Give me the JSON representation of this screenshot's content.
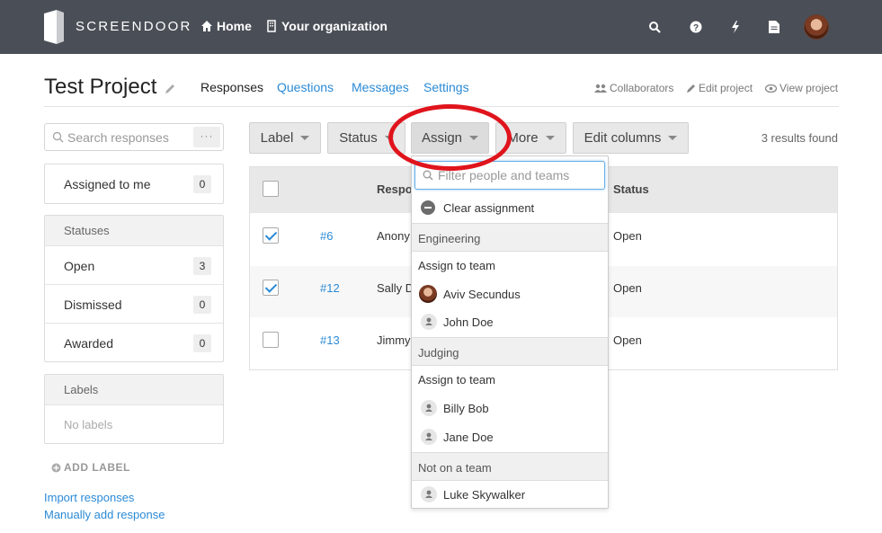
{
  "topbar": {
    "brand": "SCREENDOOR",
    "home_label": "Home",
    "org_label": "Your organization",
    "icons": [
      "search-icon",
      "help-icon",
      "bolt-icon",
      "document-icon"
    ],
    "bg_color": "#4a4f57"
  },
  "header": {
    "project_title": "Test Project",
    "tabs": [
      {
        "label": "Responses",
        "active": true
      },
      {
        "label": "Questions",
        "active": false
      },
      {
        "label": "Messages",
        "active": false
      },
      {
        "label": "Settings",
        "active": false
      }
    ],
    "right_links": [
      {
        "label": "Collaborators",
        "icon": "users-icon"
      },
      {
        "label": "Edit project",
        "icon": "pencil-icon"
      },
      {
        "label": "View project",
        "icon": "eye-icon"
      }
    ]
  },
  "sidebar": {
    "search_placeholder": "Search responses",
    "search_more": "···",
    "assigned": {
      "label": "Assigned to me",
      "count": "0"
    },
    "statuses_header": "Statuses",
    "statuses": [
      {
        "label": "Open",
        "count": "3"
      },
      {
        "label": "Dismissed",
        "count": "0"
      },
      {
        "label": "Awarded",
        "count": "0"
      }
    ],
    "labels_header": "Labels",
    "no_labels": "No labels",
    "add_label": "ADD LABEL",
    "import_link": "Import responses",
    "manual_link": "Manually add response"
  },
  "toolbar": {
    "buttons": [
      "Label",
      "Status",
      "Assign",
      "More",
      "Edit columns"
    ],
    "results": "3 results found"
  },
  "table": {
    "headers": {
      "response": "Respo",
      "status": "Status"
    },
    "rows": [
      {
        "id": "#6",
        "name": "Anony",
        "status": "Open",
        "checked": true
      },
      {
        "id": "#12",
        "name": "Sally D",
        "status": "Open",
        "checked": true
      },
      {
        "id": "#13",
        "name": "Jimmy",
        "status": "Open",
        "checked": false
      }
    ]
  },
  "assign_dropdown": {
    "filter_placeholder": "Filter people and teams",
    "clear": "Clear assignment",
    "groups": [
      {
        "name": "Engineering",
        "assign_team": "Assign to team",
        "people": [
          "Aviv Secundus",
          "John Doe"
        ]
      },
      {
        "name": "Judging",
        "assign_team": "Assign to team",
        "people": [
          "Billy Bob",
          "Jane Doe"
        ]
      },
      {
        "name": "Not on a team",
        "people": [
          "Luke Skywalker"
        ]
      }
    ]
  },
  "colors": {
    "link": "#2b8ad6",
    "highlight_ring": "#e0141c",
    "focus": "#66afe9"
  }
}
